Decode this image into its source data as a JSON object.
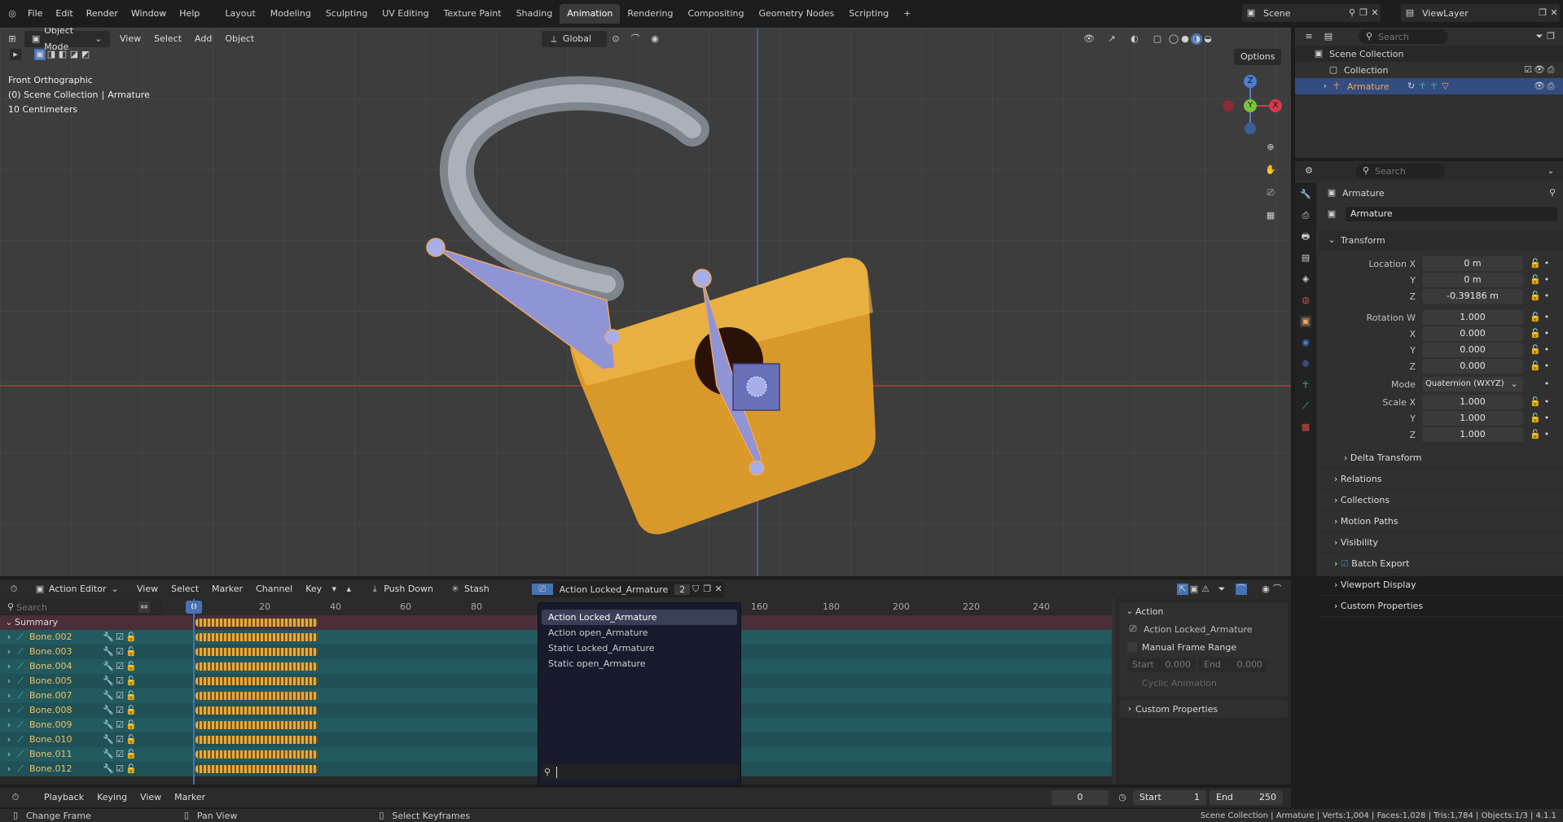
{
  "topbar": {
    "menu": [
      "File",
      "Edit",
      "Render",
      "Window",
      "Help"
    ],
    "workspaces": [
      "Layout",
      "Modeling",
      "Sculpting",
      "UV Editing",
      "Texture Paint",
      "Shading",
      "Animation",
      "Rendering",
      "Compositing",
      "Geometry Nodes",
      "Scripting"
    ],
    "active_workspace": "Animation",
    "scene": "Scene",
    "view_layer": "ViewLayer"
  },
  "viewport": {
    "mode": "Object Mode",
    "menus": [
      "View",
      "Select",
      "Add",
      "Object"
    ],
    "transform_orientation": "Global",
    "options": "Options",
    "overlay_line1": "Front Orthographic",
    "overlay_line2_a": "(0) Scene Collection",
    "overlay_line2_b": "Armature",
    "overlay_line3": "10 Centimeters",
    "gizmo": {
      "z": "Z",
      "y": "Y",
      "x": "X"
    }
  },
  "outliner": {
    "search_placeholder": "Search",
    "scene_collection": "Scene Collection",
    "collection": "Collection",
    "armature": "Armature"
  },
  "properties": {
    "search_placeholder": "Search",
    "object_name": "Armature",
    "data_name": "Armature",
    "transform_title": "Transform",
    "location_label": "Location X",
    "y_label": "Y",
    "z_label": "Z",
    "x_label": "X",
    "location": [
      "0 m",
      "0 m",
      "-0.39186 m"
    ],
    "rotation_label": "Rotation W",
    "rotation": [
      "1.000",
      "0.000",
      "0.000",
      "0.000"
    ],
    "mode_label": "Mode",
    "mode_value": "Quaternion (WXYZ)",
    "scale_label": "Scale X",
    "scale": [
      "1.000",
      "1.000",
      "1.000"
    ],
    "delta": "Delta Transform",
    "sections": [
      "Relations",
      "Collections",
      "Motion Paths",
      "Visibility",
      "Batch Export",
      "Viewport Display",
      "Custom Properties"
    ]
  },
  "action_editor": {
    "mode": "Action Editor",
    "menus": [
      "View",
      "Select",
      "Marker",
      "Channel",
      "Key"
    ],
    "push_down": "Push Down",
    "stash": "Stash",
    "action_name": "Action Locked_Armature",
    "users": "2",
    "search_placeholder": "Search",
    "frame_current": "0",
    "ruler": [
      "20",
      "40",
      "60",
      "80",
      "160",
      "180",
      "200",
      "220",
      "240"
    ],
    "summary": "Summary",
    "channels": [
      "Bone.002",
      "Bone.003",
      "Bone.004",
      "Bone.005",
      "Bone.007",
      "Bone.008",
      "Bone.009",
      "Bone.010",
      "Bone.011",
      "Bone.012"
    ],
    "dropdown": [
      "Action Locked_Armature",
      "Action open_Armature",
      "Static Locked_Armature",
      "Static open_Armature"
    ],
    "side_action_title": "Action",
    "side_action_name": "Action Locked_Armature",
    "manual_frame_range": "Manual Frame Range",
    "start_label": "Start",
    "start_value": "0.000",
    "end_label": "End",
    "end_value": "0.000",
    "cyclic": "Cyclic Animation",
    "side_custom_props": "Custom Properties"
  },
  "timeline": {
    "menus": [
      "Playback",
      "Keying",
      "View",
      "Marker"
    ],
    "current": "0",
    "start_label": "Start",
    "start": "1",
    "end_label": "End",
    "end": "250"
  },
  "statusbar": {
    "change_frame": "Change Frame",
    "pan_view": "Pan View",
    "select_keyframes": "Select Keyframes",
    "stats": "Scene Collection | Armature | Verts:1,004 | Faces:1,028 | Tris:1,784 | Objects:1/3 | 4.1.1"
  },
  "colors": {
    "accent": "#4772b3",
    "bone": "#8e94d6",
    "lock": "#e6a93a",
    "keyframe": "#e8a93a",
    "channel_bg": "#1f5156"
  }
}
